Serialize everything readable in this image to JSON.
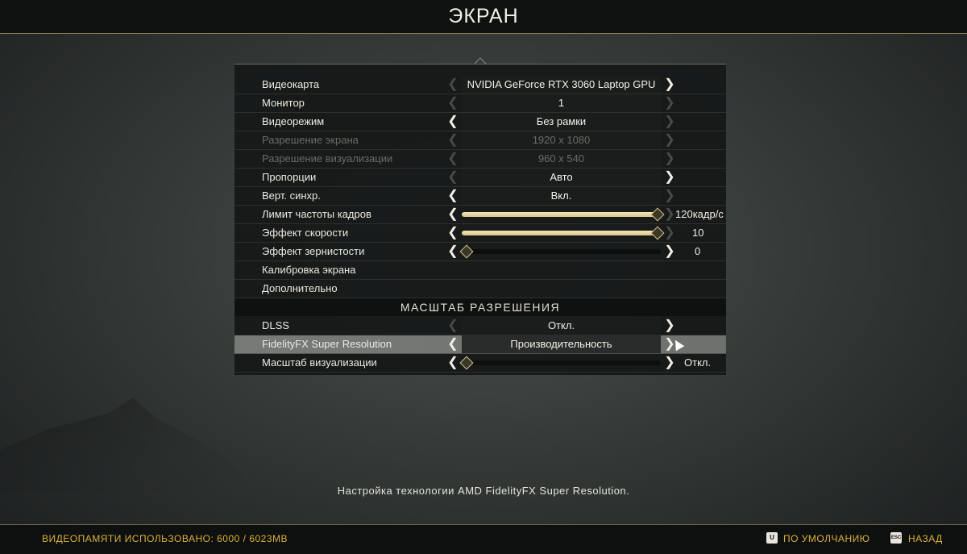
{
  "header": {
    "title": "ЭКРАН"
  },
  "settings": {
    "gpu": {
      "label": "Видеокарта",
      "value": "NVIDIA GeForce RTX 3060 Laptop GPU"
    },
    "monitor": {
      "label": "Монитор",
      "value": "1"
    },
    "display_mode": {
      "label": "Видеорежим",
      "value": "Без рамки"
    },
    "screen_res": {
      "label": "Разрешение экрана",
      "value": "1920 x 1080"
    },
    "render_res": {
      "label": "Разрешение визуализации",
      "value": "960 x 540"
    },
    "aspect": {
      "label": "Пропорции",
      "value": "Авто"
    },
    "vsync": {
      "label": "Верт. синхр.",
      "value": "Вкл."
    },
    "fps_limit": {
      "label": "Лимит частоты кадров",
      "display": "120кадр/с",
      "level": 1.0
    },
    "motion_blur": {
      "label": "Эффект скорости",
      "display": "10",
      "level": 1.0
    },
    "film_grain": {
      "label": "Эффект зернистости",
      "display": "0",
      "level": 0.0
    },
    "calibration": {
      "label": "Калибровка экрана"
    },
    "advanced": {
      "label": "Дополнительно"
    },
    "section_title": "МАСШТАБ РАЗРЕШЕНИЯ",
    "dlss": {
      "label": "DLSS",
      "value": "Откл."
    },
    "fsr": {
      "label": "FidelityFX Super Resolution",
      "value": "Производительность"
    },
    "render_scale": {
      "label": "Масштаб визуализации",
      "display": "Откл.",
      "level": 0.0
    }
  },
  "hint": "Настройка технологии AMD FidelityFX Super Resolution.",
  "footer": {
    "vram": "ВИДЕОПАМЯТИ ИСПОЛЬЗОВАНО: 6000 / 6023MB",
    "defaults_key": "U",
    "defaults_label": "ПО УМОЛЧАНИЮ",
    "back_key": "ESC",
    "back_label": "НАЗАД"
  },
  "colors": {
    "accent": "#d9b23c",
    "slider_fill": "#e6d7a0"
  }
}
